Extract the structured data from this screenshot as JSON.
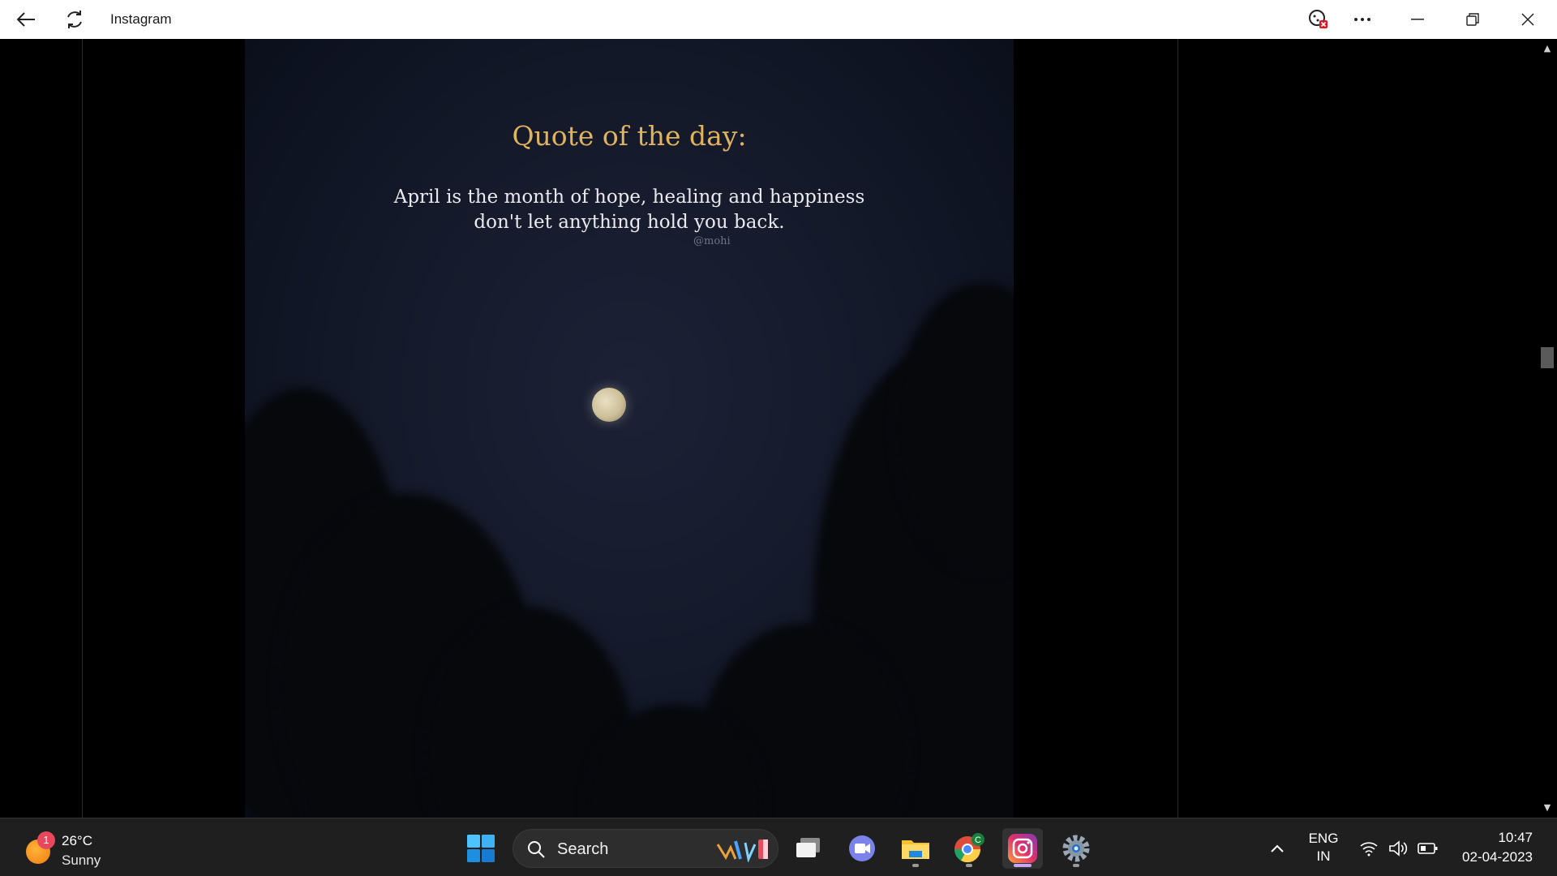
{
  "window": {
    "title": "Instagram"
  },
  "post": {
    "heading": "Quote of the day:",
    "quote_line1": "April is the month of hope, healing and happiness",
    "quote_line2": "don't let anything hold you back.",
    "handle": "@mohi"
  },
  "taskbar": {
    "weather": {
      "badge": "1",
      "temperature": "26°C",
      "condition": "Sunny"
    },
    "search_label": "Search",
    "language_line1": "ENG",
    "language_line2": "IN",
    "time": "10:47",
    "date": "02-04-2023"
  },
  "colors": {
    "quote_heading": "#e0b35f",
    "active_indicator": "#c9a4ff"
  }
}
